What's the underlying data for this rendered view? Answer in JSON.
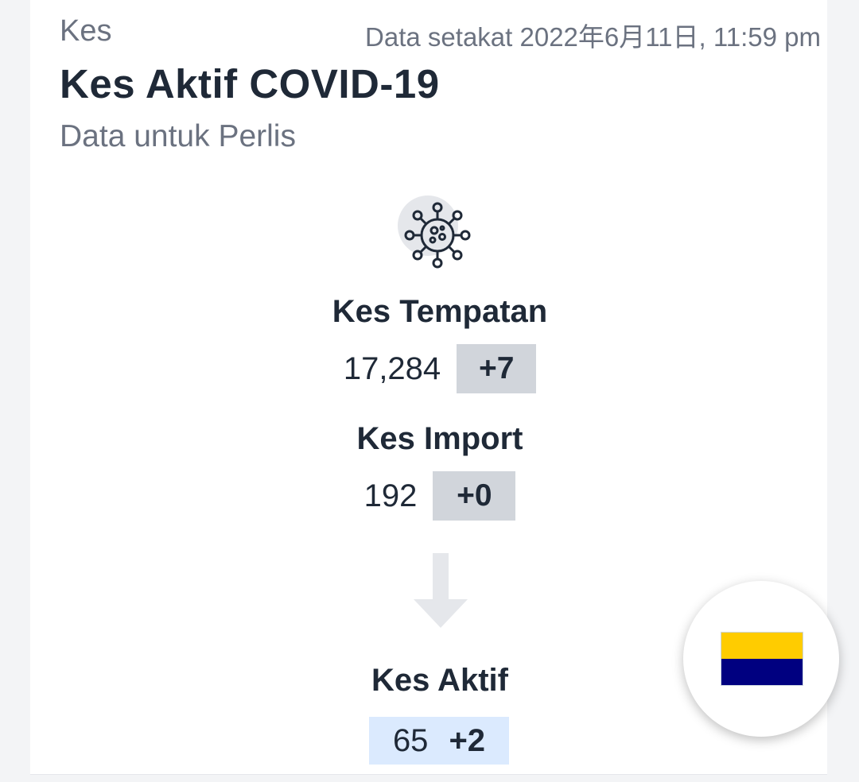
{
  "header": {
    "eyebrow": "Kes",
    "updated": "Data setakat 2022年6月11日, 11:59 pm",
    "title": "Kes Aktif COVID-19",
    "subtitle": "Data untuk Perlis"
  },
  "local": {
    "label": "Kes Tempatan",
    "value": "17,284",
    "delta": "+7"
  },
  "imported": {
    "label": "Kes Import",
    "value": "192",
    "delta": "+0"
  },
  "active": {
    "label": "Kes Aktif",
    "value": "65",
    "delta": "+2"
  },
  "icons": {
    "virus": "virus-icon",
    "arrow": "arrow-down-icon",
    "flag": "state-flag-icon"
  },
  "colors": {
    "flag_top": "#ffcc00",
    "flag_bottom": "#000080",
    "delta_bg": "#d1d5db",
    "active_bg": "#dbeafe"
  }
}
